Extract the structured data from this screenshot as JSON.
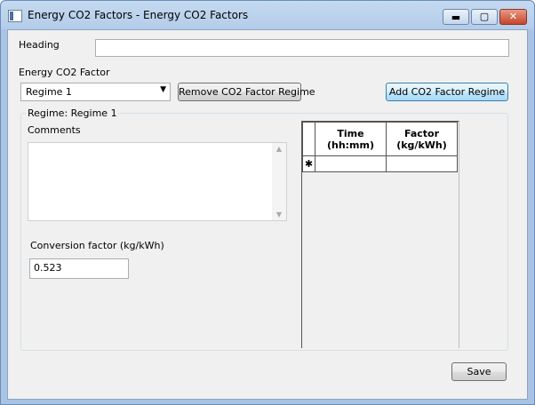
{
  "window": {
    "title": "Energy CO2 Factors - Energy CO2 Factors",
    "minimize_glyph": "▬",
    "maximize_glyph": "▢",
    "close_glyph": "✕"
  },
  "form": {
    "heading_label": "Heading",
    "heading_value": "",
    "factor_label": "Energy CO2 Factor",
    "regime_selected": "Regime 1",
    "remove_button": "Remove CO2 Factor Regime",
    "add_button": "Add CO2 Factor Regime",
    "group_title": "Regime: Regime 1",
    "comments_label": "Comments",
    "comments_value": "",
    "conversion_label": "Conversion factor (kg/kWh)",
    "conversion_value": "0.523",
    "save_button": "Save"
  },
  "grid": {
    "columns": [
      {
        "line1": "Time",
        "line2": "(hh:mm)"
      },
      {
        "line1": "Factor",
        "line2": "(kg/kWh)"
      }
    ],
    "new_row_marker": "✱"
  },
  "icons": {
    "dropdown": "chevron-down-icon",
    "app": "app-icon"
  },
  "colors": {
    "titlebar": "#b9d1ea",
    "focused_button": "#3c7fb1",
    "close_button": "#c8442b"
  }
}
